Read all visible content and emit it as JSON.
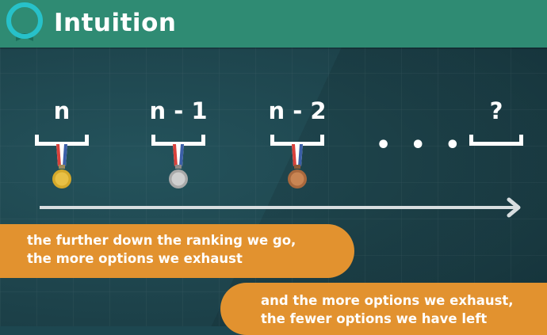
{
  "header": {
    "title": "Intuition",
    "icon": "circle-logo-icon",
    "color": "#2f8b73"
  },
  "ranking": {
    "slots": [
      {
        "label": "n",
        "medal": "gold-medal-icon"
      },
      {
        "label": "n - 1",
        "medal": "silver-medal-icon"
      },
      {
        "label": "n - 2",
        "medal": "bronze-medal-icon"
      },
      {
        "label": "?",
        "medal": ""
      }
    ],
    "ellipsis": "• • •"
  },
  "captions": {
    "first": {
      "line1": "the further down the ranking we go,",
      "line2": "the more options we exhaust"
    },
    "second": {
      "line1": "and the more options we exhaust,",
      "line2": "the fewer options we have left"
    },
    "color": "#e2922f"
  }
}
